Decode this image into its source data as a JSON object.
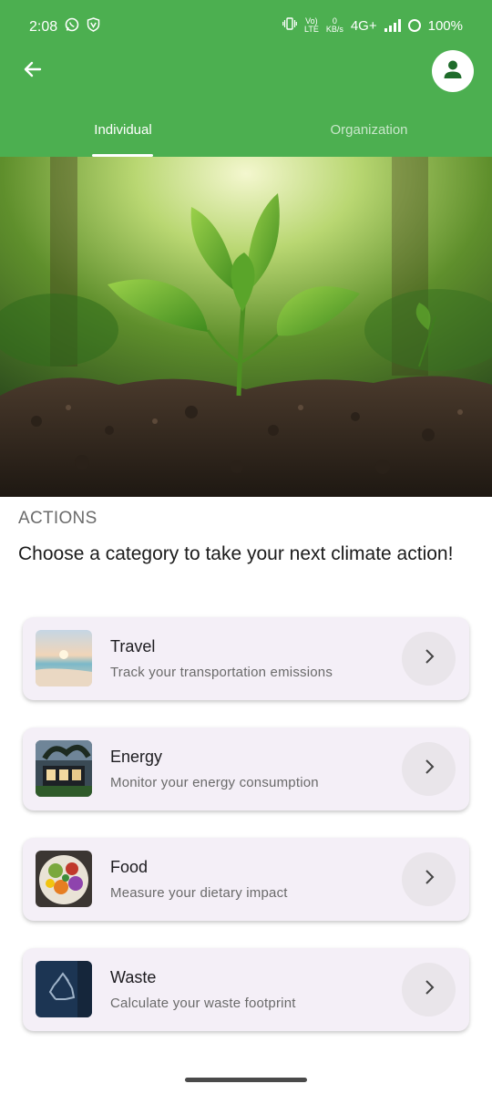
{
  "status_bar": {
    "time": "2:08",
    "network_type": "4G+",
    "speed_value": "0",
    "speed_unit": "KB/s",
    "volte_top": "Vo)",
    "volte_bottom": "LTE",
    "battery": "100%",
    "icons": [
      "whatsapp-icon",
      "shield-v-icon",
      "vibrate-icon",
      "signal-icon",
      "battery-ring-icon"
    ]
  },
  "header": {
    "back_icon": "arrow-left-icon",
    "profile_icon": "person-icon",
    "accent_color": "#4caf50"
  },
  "tabs": [
    {
      "label": "Individual",
      "active": true
    },
    {
      "label": "Organization",
      "active": false
    }
  ],
  "main": {
    "section_label": "ACTIONS",
    "headline": "Choose a category to take your next climate action!",
    "categories": [
      {
        "title": "Travel",
        "subtitle": "Track your transportation emissions"
      },
      {
        "title": "Energy",
        "subtitle": "Monitor your energy consumption"
      },
      {
        "title": "Food",
        "subtitle": "Measure your dietary impact"
      },
      {
        "title": "Waste",
        "subtitle": "Calculate your waste footprint"
      }
    ]
  }
}
